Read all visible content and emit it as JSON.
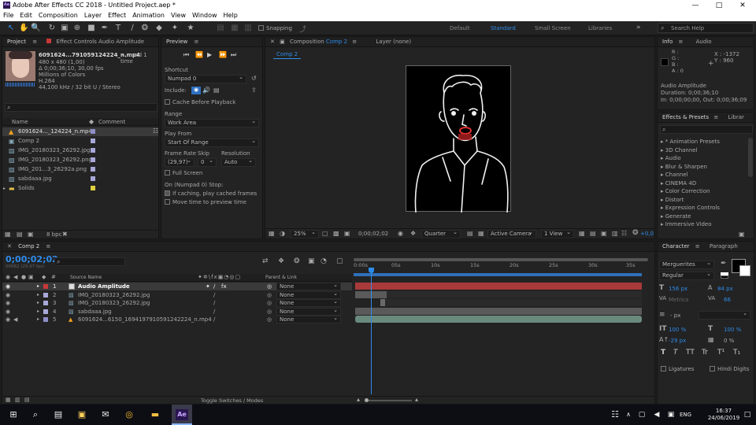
{
  "window": {
    "title": "Adobe After Effects CC 2018 - Untitled Project.aep *",
    "minimize": "—",
    "maximize": "□",
    "close": "✕"
  },
  "menu": [
    "File",
    "Edit",
    "Composition",
    "Layer",
    "Effect",
    "Animation",
    "View",
    "Window",
    "Help"
  ],
  "toolbar": {
    "snapping": "Snapping",
    "workspaces": [
      "Default",
      "Standard",
      "Small Screen",
      "Libraries"
    ],
    "search_placeholder": "Search Help"
  },
  "project": {
    "tab_project": "Project",
    "tab_effect_controls": "Effect Controls Audio Amplitude",
    "asset_name": "6091624...791059124224_n.mp4",
    "asset_used": "▾ , used 1 time",
    "asset_info": [
      "480 x 480 (1,00)",
      "Δ 0;00;36;10, 30,00 fps",
      "Millions of Colors",
      "H.264",
      "44,100 kHz / 32 bit U / Stereo"
    ],
    "col_name": "Name",
    "col_comment": "Comment",
    "items": [
      {
        "name": "6091624..._124224_n.mp4",
        "color": "#8e8ec8"
      },
      {
        "name": "Comp 2",
        "color": "#a8a8d8"
      },
      {
        "name": "IMG_20180323_26292.jpg",
        "color": "#a8a8d8"
      },
      {
        "name": "IMG_20180323_26292.png",
        "color": "#a8a8d8"
      },
      {
        "name": "IMG_201...3_26292a.png",
        "color": "#a8a8d8"
      },
      {
        "name": "sabdaaa.jpg",
        "color": "#a8a8d8"
      },
      {
        "name": "Solids",
        "color": "#e0d040"
      }
    ],
    "bpc": "8 bpc"
  },
  "preview": {
    "title": "Preview",
    "shortcut_label": "Shortcut",
    "shortcut_value": "Numpad 0",
    "include_label": "Include:",
    "cache_before": "Cache Before Playback",
    "range_label": "Range",
    "range_value": "Work Area",
    "play_from_label": "Play From",
    "play_from_value": "Start Of Range",
    "frame_rate_label": "Frame Rate",
    "skip_label": "Skip",
    "resolution_label": "Resolution",
    "frame_rate_value": "(29,97)",
    "skip_value": "0",
    "resolution_value": "Auto",
    "full_screen": "Full Screen",
    "stop_label": "On (Numpad 0) Stop:",
    "if_caching": "If caching, play cached frames",
    "move_time": "Move time to preview time"
  },
  "composition": {
    "tab": "Composition",
    "tab_name": "Comp 2",
    "layer_tab": "Layer (none)",
    "subtab": "Comp 2",
    "zoom": "25%",
    "timecode": "0;00;02;02",
    "quality": "Quarter",
    "camera": "Active Camera",
    "views": "1 View",
    "exposure": "+0,0"
  },
  "info": {
    "tab_info": "Info",
    "tab_audio": "Audio",
    "r": "R :",
    "g": "G :",
    "b": "B :",
    "a": "A : 0",
    "x": "X : -1372",
    "y": "Y : 960",
    "details": [
      "Audio Amplitude",
      "Duration: 0;00;36;10",
      "In: 0;00;00;00, Out: 0;00;36;09"
    ]
  },
  "effects": {
    "tab": "Effects & Presets",
    "tab2": "Librar",
    "items": [
      "* Animation Presets",
      "3D Channel",
      "Audio",
      "Blur & Sharpen",
      "Channel",
      "CINEMA 4D",
      "Color Correction",
      "Distort",
      "Expression Controls",
      "Generate",
      "Immersive Video"
    ]
  },
  "character": {
    "tab": "Character",
    "tab2": "Paragraph",
    "font": "Merguerites",
    "style": "Regular",
    "size": "156 px",
    "leading": "84 px",
    "kerning": "Metrics",
    "tracking": "66",
    "stroke": "- px",
    "vscale": "100 %",
    "hscale": "100 %",
    "baseline": "-29 px",
    "tsume": "0 %",
    "ligatures": "Ligatures",
    "hindi": "Hindi Digits",
    "styles": [
      "T",
      "T",
      "TT",
      "Tr",
      "T¹",
      "T₁"
    ]
  },
  "timeline": {
    "tab": "Comp 2",
    "timecode": "0;00;02;02",
    "frame_info": "00062 (29.97 fps)",
    "col_source": "Source Name",
    "col_parent": "Parent & Link",
    "layers": [
      {
        "num": "1",
        "name": "Audio Amplitude",
        "parent": "None",
        "color": "#c83838"
      },
      {
        "num": "2",
        "name": "IMG_20180323_26292.jpg",
        "parent": "None",
        "color": "#a8a8d8"
      },
      {
        "num": "3",
        "name": "IMG_20180323_26292.jpg",
        "parent": "None",
        "color": "#a8a8d8"
      },
      {
        "num": "4",
        "name": "sabdaaa.jpg",
        "parent": "None",
        "color": "#a8a8d8"
      },
      {
        "num": "5",
        "name": "6091624...6150_1694197910591242224_n.mp4",
        "parent": "None",
        "color": "#8e8ec8"
      }
    ],
    "ruler": [
      "0:00s",
      "05s",
      "10s",
      "15s",
      "20s",
      "25s",
      "30s",
      "35s"
    ],
    "toggle": "Toggle Switches / Modes"
  },
  "taskbar": {
    "time": "16:37",
    "date": "24/06/2019",
    "lang": "ENG",
    "app": "Ae"
  }
}
